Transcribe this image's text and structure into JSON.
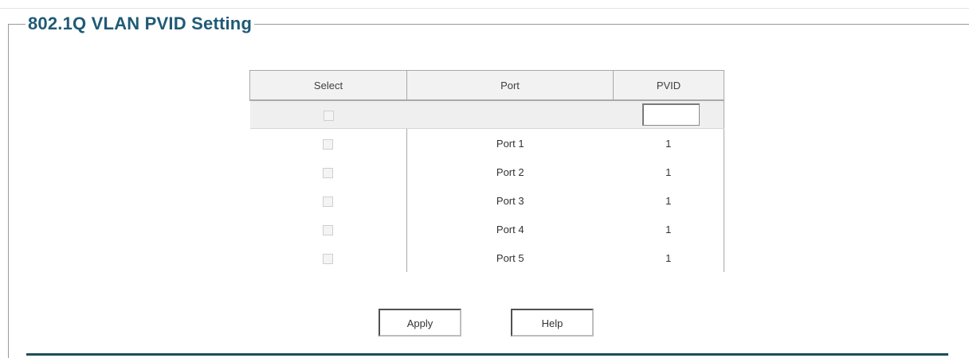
{
  "section": {
    "title": "802.1Q VLAN PVID Setting"
  },
  "table": {
    "headers": {
      "select": "Select",
      "port": "Port",
      "pvid": "PVID"
    },
    "edit_row": {
      "pvid_value": ""
    },
    "rows": [
      {
        "port": "Port 1",
        "pvid": "1",
        "selected": false
      },
      {
        "port": "Port 2",
        "pvid": "1",
        "selected": false
      },
      {
        "port": "Port 3",
        "pvid": "1",
        "selected": false
      },
      {
        "port": "Port 4",
        "pvid": "1",
        "selected": false
      },
      {
        "port": "Port 5",
        "pvid": "1",
        "selected": false
      }
    ]
  },
  "buttons": {
    "apply": "Apply",
    "help": "Help"
  },
  "colors": {
    "title": "#1f5a75",
    "bottom_rule": "#1c4e57",
    "header_bg": "#f2f2f2",
    "edit_row_bg": "#efefef"
  }
}
